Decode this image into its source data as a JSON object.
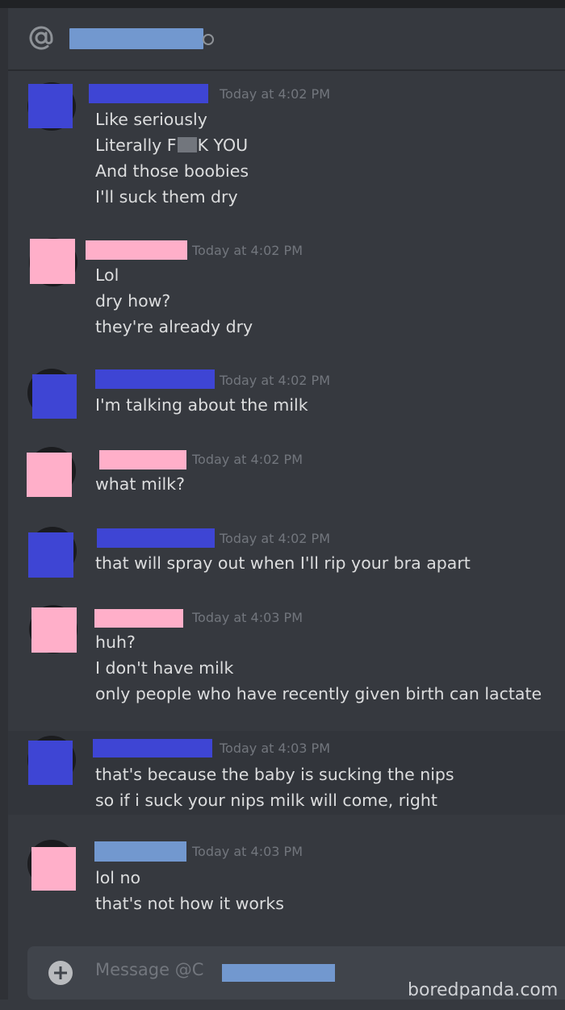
{
  "header": {
    "at_icon": "at-icon",
    "recipient_name": "",
    "status_icon": "status-offline-icon"
  },
  "colors": {
    "background": "#36393f",
    "text": "#dcddde",
    "timestamp": "#72767d",
    "redact_blue": "#3e45d4",
    "redact_pink": "#ffafc9",
    "redact_lightblue": "#7298cf"
  },
  "messages": [
    {
      "author": "blue",
      "timestamp": "Today at 4:02 PM",
      "lines": [
        "Like seriously",
        "Literally F",
        "And those boobies",
        "I'll suck them dry"
      ],
      "censor_after": "K YOU"
    },
    {
      "author": "pink",
      "timestamp": "Today at 4:02 PM",
      "lines": [
        "Lol",
        "dry how?",
        "they're already dry"
      ]
    },
    {
      "author": "blue",
      "timestamp": "Today at 4:02 PM",
      "lines": [
        "I'm talking about the milk"
      ]
    },
    {
      "author": "pink",
      "timestamp": "Today at 4:02 PM",
      "lines": [
        "what milk?"
      ]
    },
    {
      "author": "blue",
      "timestamp": "Today at 4:02 PM",
      "lines": [
        "that will spray out when I'll rip your bra apart"
      ]
    },
    {
      "author": "pink",
      "timestamp": "Today at 4:03 PM",
      "lines": [
        "huh?",
        "I don't have milk",
        "only people who have recently given birth can lactate"
      ]
    },
    {
      "author": "blue",
      "timestamp": "Today at 4:03 PM",
      "lines": [
        "that's because the baby is sucking the nips",
        "so if i suck your nips milk will come, right"
      ]
    },
    {
      "author": "pink",
      "timestamp": "Today at 4:03 PM",
      "lines": [
        "lol no",
        "that's not how it works"
      ]
    }
  ],
  "composer": {
    "add_icon": "plus-circle-icon",
    "placeholder": "Message @C"
  },
  "watermark": "boredpanda.com"
}
